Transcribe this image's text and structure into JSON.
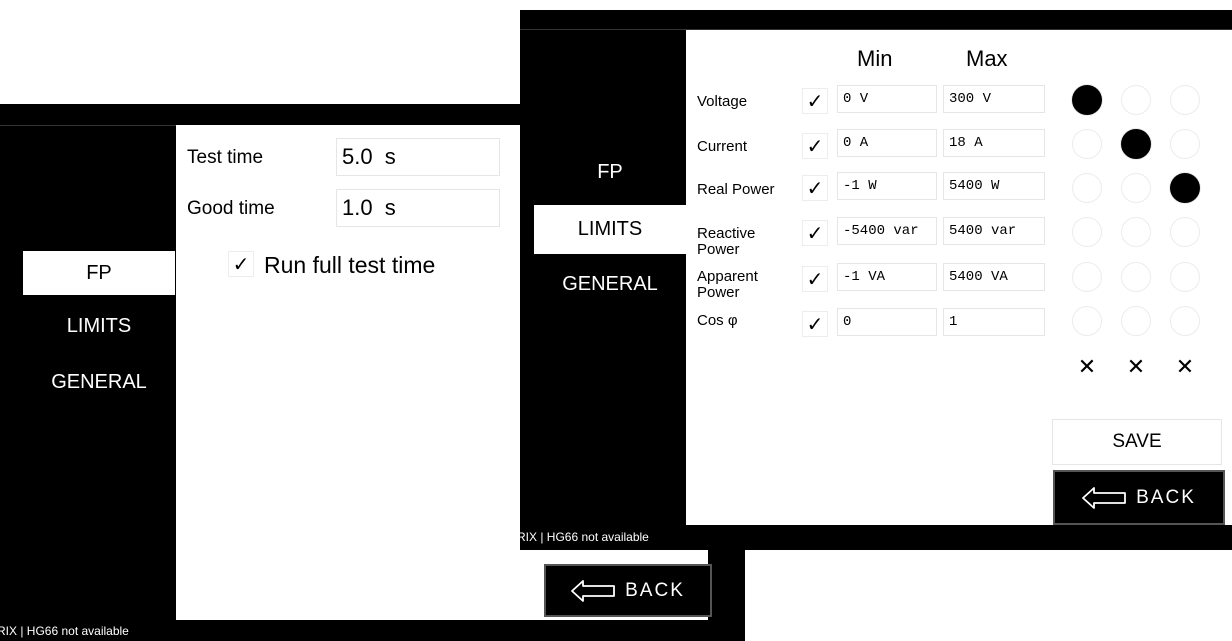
{
  "back_window": {
    "nav": [
      "FP",
      "LIMITS",
      "GENERAL"
    ],
    "active_nav": "FP",
    "test_time": {
      "label": "Test time",
      "value": "5.0  s"
    },
    "good_time": {
      "label": "Good time",
      "value": "1.0  s"
    },
    "run_full": {
      "label": "Run full test time",
      "checked": true
    },
    "status": "RIX | HG66 not available",
    "back_label": "BACK"
  },
  "front_window": {
    "nav": [
      "FP",
      "LIMITS",
      "GENERAL"
    ],
    "active_nav": "LIMITS",
    "headers": {
      "min": "Min",
      "max": "Max"
    },
    "rows": [
      {
        "label": "Voltage",
        "checked": true,
        "min": "0 V",
        "max": "300 V",
        "selected_radio": 0
      },
      {
        "label": "Current",
        "checked": true,
        "min": "0 A",
        "max": "18 A",
        "selected_radio": 1
      },
      {
        "label": "Real Power",
        "checked": true,
        "min": "-1 W",
        "max": "5400 W",
        "selected_radio": 2
      },
      {
        "label": "Reactive Power",
        "checked": true,
        "min": "-5400 var",
        "max": "5400 var",
        "selected_radio": null
      },
      {
        "label": "Apparent Power",
        "checked": true,
        "min": "-1 VA",
        "max": "5400 VA",
        "selected_radio": null
      },
      {
        "label": "Cos φ",
        "checked": true,
        "min": "0",
        "max": "1",
        "selected_radio": null
      }
    ],
    "clear_symbols": [
      "✕",
      "✕",
      "✕"
    ],
    "save_label": "SAVE",
    "back_label": "BACK",
    "status": "RIX | HG66 not available"
  },
  "icons": {
    "check": "✓",
    "back_arrow": "left-arrow-icon"
  }
}
